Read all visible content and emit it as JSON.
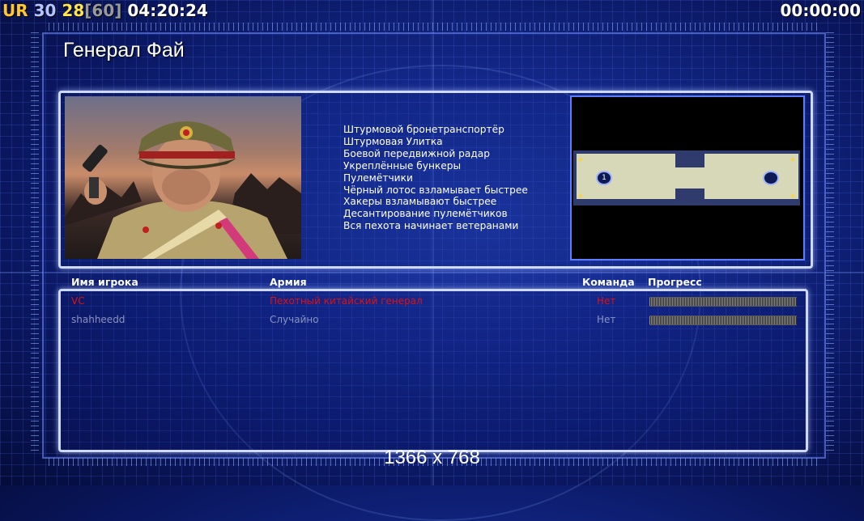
{
  "hud": {
    "left_prefix": "UR",
    "left_value1": "30",
    "left_value2": "28",
    "left_bracket": "[60]",
    "left_time": "04:20:24",
    "right_time": "00:00:00"
  },
  "general": {
    "name": "Генерал Фай",
    "features": [
      "Штурмовой бронетранспортёр",
      "Штурмовая Улитка",
      "Боевой передвижной радар",
      "Укреплённые бункеры",
      "Пулемётчики",
      "Чёрный лотос взламывает быстрее",
      "Хакеры взламывают быстрее",
      "Десантирование пулемётчиков",
      "Вся пехота начинает ветеранами"
    ]
  },
  "minimap": {
    "start_positions": [
      "1",
      ""
    ]
  },
  "table": {
    "headers": {
      "player": "Имя игрока",
      "army": "Армия",
      "team": "Команда",
      "progress": "Прогресс"
    },
    "rows": [
      {
        "player": "VC",
        "army": "Пехотный китайский генерал",
        "team": "Нет",
        "color": "#e01010",
        "progress": 0
      },
      {
        "player": "shahheedd",
        "army": "Случайно",
        "team": "Нет",
        "color": "#8a92c0",
        "progress": 0
      }
    ]
  },
  "footer": {
    "resolution": "1366 x 768"
  }
}
